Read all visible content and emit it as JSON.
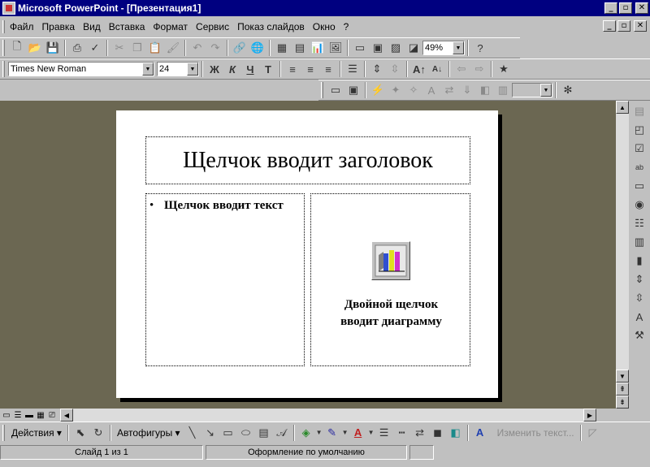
{
  "window": {
    "title": "Microsoft PowerPoint - [Презентация1]",
    "controls": [
      "_",
      "▫",
      "✕"
    ]
  },
  "menu": [
    {
      "label": "Файл"
    },
    {
      "label": "Правка"
    },
    {
      "label": "Вид"
    },
    {
      "label": "Вставка"
    },
    {
      "label": "Формат"
    },
    {
      "label": "Сервис"
    },
    {
      "label": "Показ слайдов"
    },
    {
      "label": "Окно"
    },
    {
      "label": "?"
    }
  ],
  "standard_toolbar": {
    "zoom": "49%",
    "icons": [
      "new-icon",
      "open-icon",
      "save-icon",
      "print-icon",
      "spelling-icon",
      "cut-icon",
      "copy-icon",
      "paste-icon",
      "format-painter-icon",
      "undo-icon",
      "redo-icon",
      "hyperlink-icon",
      "web-icon",
      "insert-table-icon",
      "insert-excel-icon",
      "insert-chart-icon",
      "clipart-icon",
      "new-slide-icon",
      "slide-layout-icon",
      "apply-design-icon",
      "grayscale-icon",
      "help-icon"
    ]
  },
  "formatting_toolbar": {
    "font": "Times New Roman",
    "size": "24",
    "bold": "Ж",
    "italic": "К",
    "underline": "Ч",
    "shadow": "Т"
  },
  "slide": {
    "title_placeholder": "Щелчок вводит заголовок",
    "text_placeholder": "Щелчок вводит текст",
    "bullet": "•",
    "chart_placeholder_line1": "Двойной щелчок",
    "chart_placeholder_line2": "вводит диаграмму"
  },
  "drawing_toolbar": {
    "actions": "Действия",
    "autoshapes": "Автофигуры",
    "change_text": "Изменить текст..."
  },
  "status": {
    "slide": "Слайд 1 из 1",
    "design": "Оформление по умолчанию"
  },
  "colors": {
    "titlebar": "#000080",
    "workspace": "#6b6752",
    "face": "#c0c0c0"
  }
}
